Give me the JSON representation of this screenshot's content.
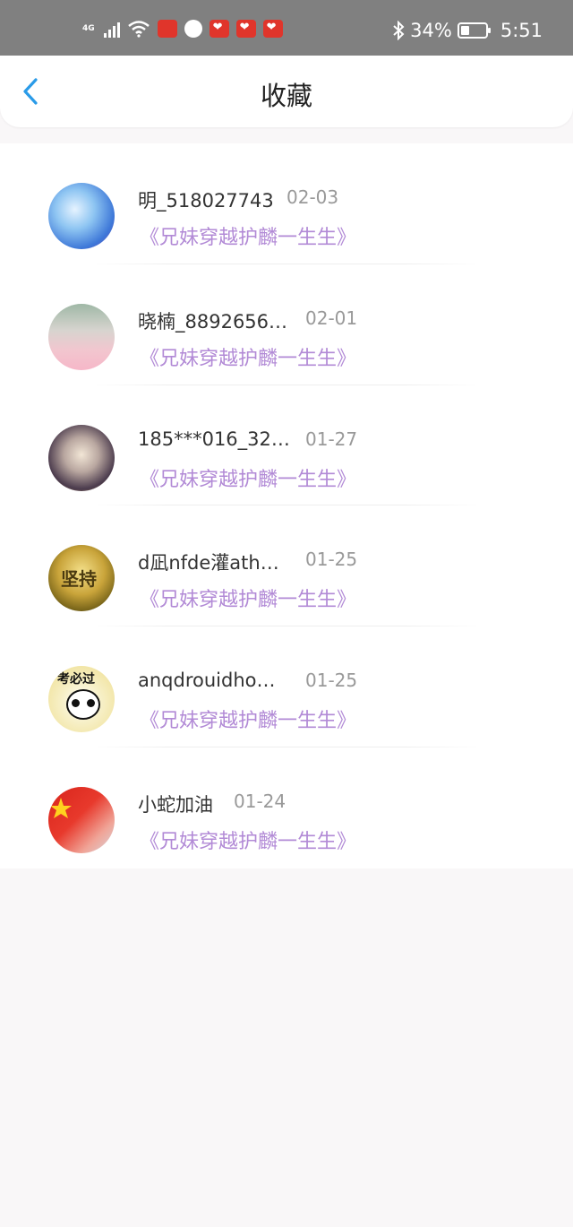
{
  "status_bar": {
    "network": "4G",
    "battery": "34%",
    "battery_level": 0.34,
    "time": "5:51",
    "icons": [
      "signal-icon",
      "wifi-icon",
      "huawei-app-icon",
      "browser-icon",
      "pinduoduo-icon",
      "pinduoduo-icon",
      "pinduoduo-icon",
      "bluetooth-icon",
      "battery-icon"
    ]
  },
  "header": {
    "title": "收藏",
    "back_icon": "chevron-left-icon",
    "accent": "#2a9be8"
  },
  "list": {
    "items": [
      {
        "name": "明_518027743",
        "date": "02-03",
        "book": "《兄妹穿越护麟一生生》"
      },
      {
        "name": "晓楠_8892656…",
        "date": "02-01",
        "book": "《兄妹穿越护麟一生生》"
      },
      {
        "name": "185***016_32…",
        "date": "01-27",
        "book": "《兄妹穿越护麟一生生》"
      },
      {
        "name": "d凪nfde灌ath…",
        "date": "01-25",
        "book": "《兄妹穿越护麟一生生》",
        "avatar_text": "坚持"
      },
      {
        "name": "anqdrouidho…",
        "date": "01-25",
        "book": "《兄妹穿越护麟一生生》",
        "avatar_text": "考必过"
      },
      {
        "name": "小蛇加油",
        "date": "01-24",
        "book": "《兄妹穿越护麟一生生》"
      }
    ]
  },
  "colors": {
    "book_title": "#b28ad6",
    "date": "#999999",
    "name": "#333333"
  }
}
